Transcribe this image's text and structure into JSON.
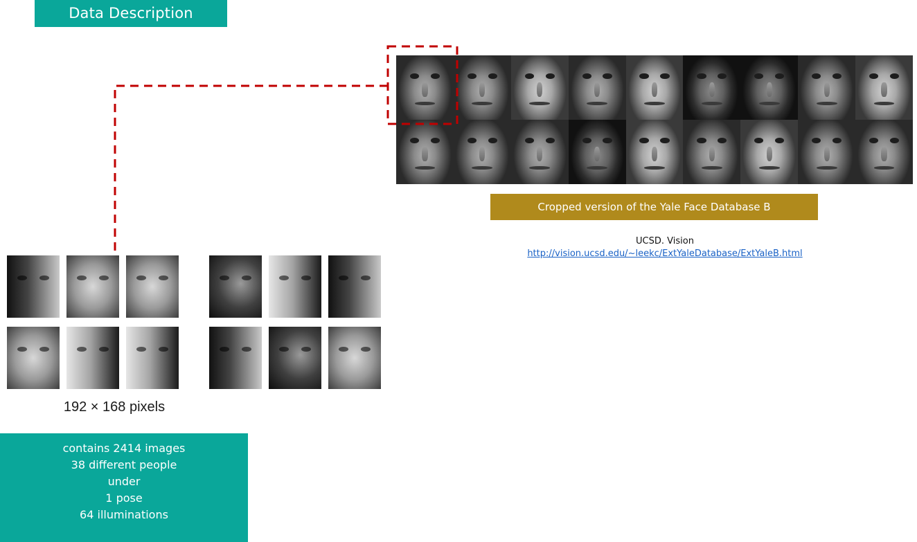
{
  "slide": {
    "title": "Data Description",
    "dataset_caption": "Cropped version of the Yale Face Database B",
    "credit_org": "UCSD. Vision",
    "credit_url": "http://vision.ucsd.edu/~leekc/ExtYaleDatabase/ExtYaleB.html",
    "image_size": "192 × 168 pixels",
    "stats": [
      "contains 2414 images",
      "38 different people",
      "under",
      "1 pose",
      "64 illuminations"
    ]
  },
  "colors": {
    "title_bg": "#0aa79a",
    "caption_bg": "#b08a1c",
    "dash": "#c00000",
    "link": "#1a62c6"
  }
}
